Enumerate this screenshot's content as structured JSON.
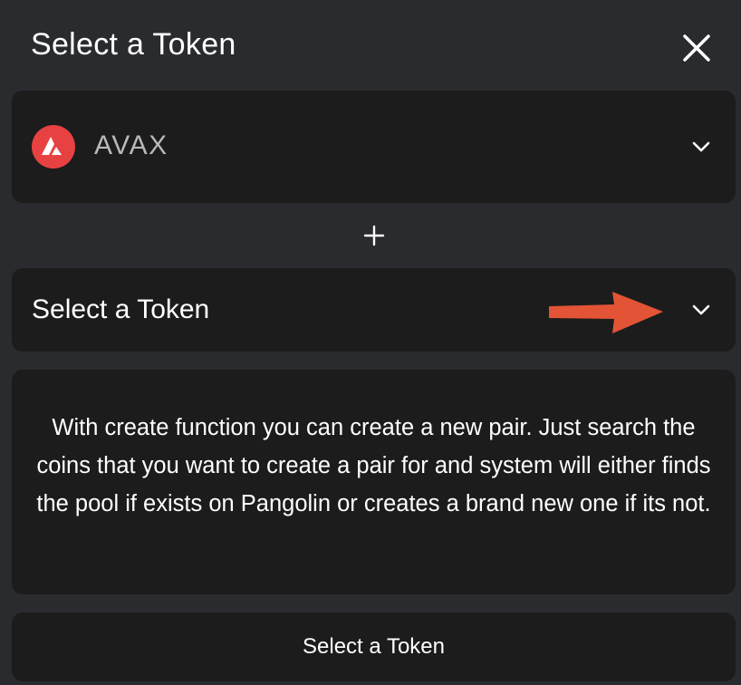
{
  "header": {
    "title": "Select a Token",
    "close_icon": "close-icon"
  },
  "token_a": {
    "symbol": "AVAX",
    "logo_icon": "avax-logo-icon",
    "logo_color": "#e84142",
    "dropdown_icon": "chevron-down-icon"
  },
  "plus_icon": "plus-icon",
  "token_b": {
    "label": "Select a Token",
    "dropdown_icon": "chevron-down-icon"
  },
  "annotation": {
    "icon": "arrow-right-icon",
    "color": "#e35335"
  },
  "info": {
    "text": "With create function you can create a new pair. Just search the coins that you want to create a pair for and system will either finds the pool if exists on Pangolin or creates a brand new one if its not."
  },
  "footer": {
    "button_label": "Select a Token"
  },
  "colors": {
    "background": "#2a2b2f",
    "card": "#1c1c1c",
    "text": "#ffffff",
    "muted_text": "#b9b9b9"
  }
}
